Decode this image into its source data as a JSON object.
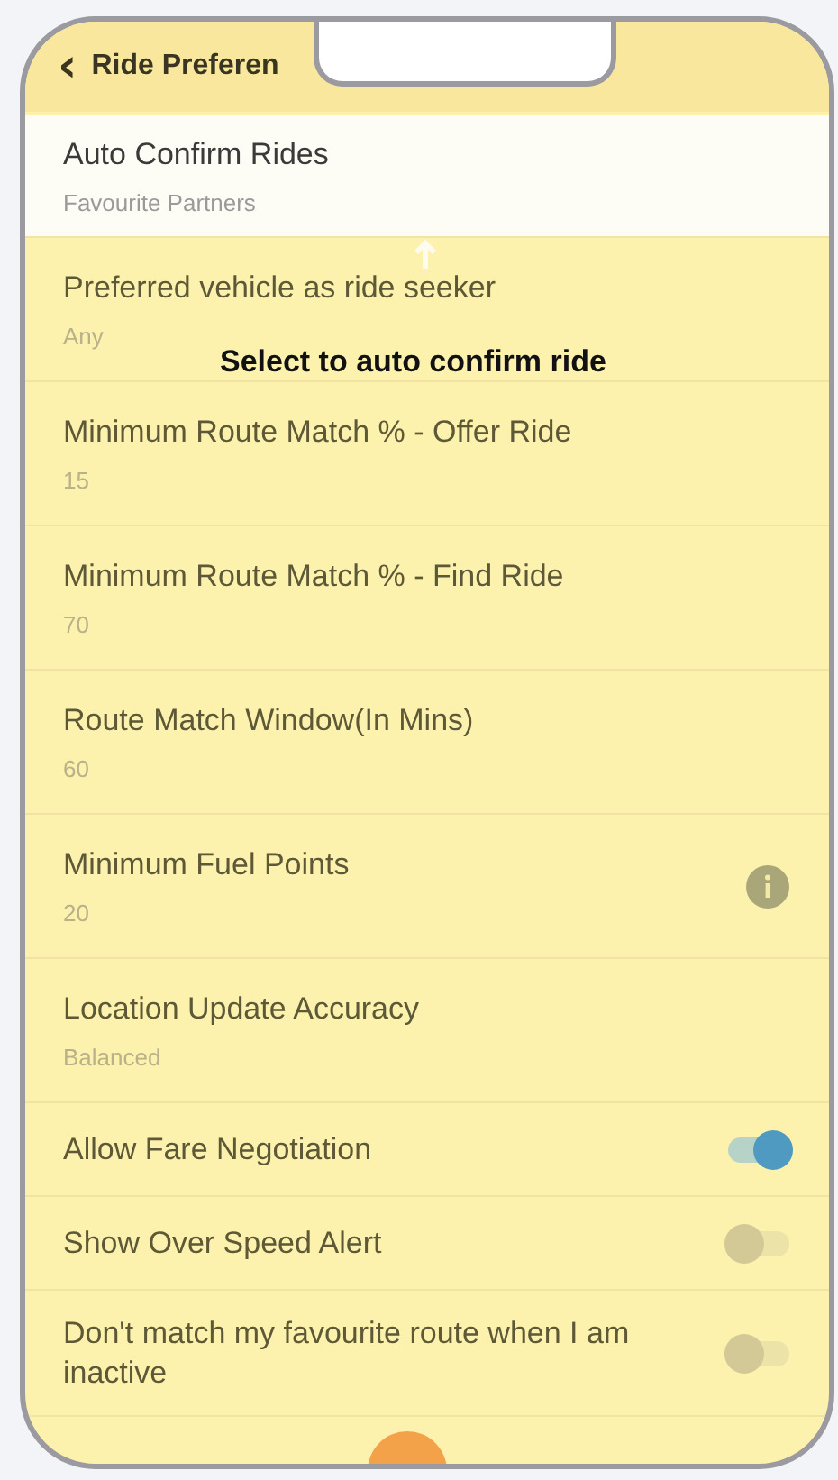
{
  "header": {
    "back_icon": "‹",
    "title": "Ride Preferen"
  },
  "tooltip": {
    "text": "Select to auto confirm ride"
  },
  "rows": [
    {
      "kind": "value",
      "title": "Auto Confirm Rides",
      "value": "Favourite Partners",
      "selected": true
    },
    {
      "kind": "value",
      "title": "Preferred vehicle as ride seeker",
      "value": "Any",
      "selected": false
    },
    {
      "kind": "value",
      "title": "Minimum Route Match % - Offer Ride",
      "value": "15",
      "selected": false
    },
    {
      "kind": "value",
      "title": "Minimum Route Match % - Find Ride",
      "value": "70",
      "selected": false
    },
    {
      "kind": "value",
      "title": "Route Match Window(In Mins)",
      "value": "60",
      "selected": false
    },
    {
      "kind": "info",
      "title": "Minimum Fuel Points",
      "value": "20",
      "selected": false
    },
    {
      "kind": "value",
      "title": "Location Update Accuracy",
      "value": "Balanced",
      "selected": false
    },
    {
      "kind": "toggle",
      "title": "Allow Fare Negotiation",
      "on": true,
      "selected": false
    },
    {
      "kind": "toggle",
      "title": "Show Over Speed Alert",
      "on": false,
      "selected": false
    },
    {
      "kind": "toggle",
      "title": "Don't match my favourite route when I am inactive",
      "on": false,
      "selected": false
    }
  ]
}
